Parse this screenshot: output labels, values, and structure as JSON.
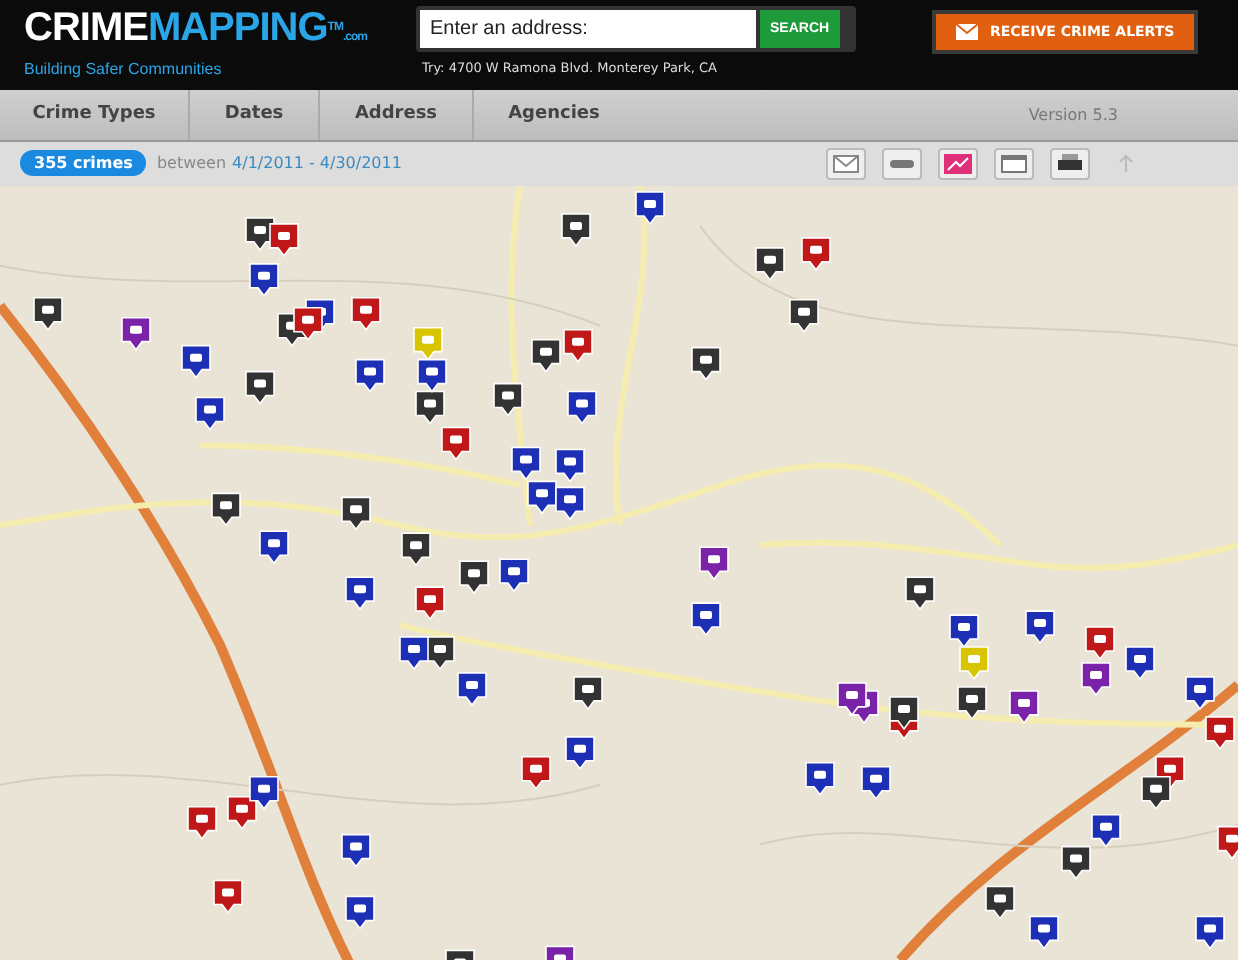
{
  "logo": {
    "part_1": "CRIME",
    "part_2": "MAPPING",
    "mark": "TM",
    "domain": ".com",
    "tagline": "Building Safer Communities"
  },
  "search": {
    "placeholder": "Enter an address:",
    "button": "SEARCH",
    "hint": "Try: 4700 W Ramona Blvd. Monterey Park, CA"
  },
  "alerts_button": "RECEIVE CRIME ALERTS",
  "nav": {
    "items": [
      {
        "label": "Crime Types"
      },
      {
        "label": "Dates"
      },
      {
        "label": "Address"
      },
      {
        "label": "Agencies"
      }
    ],
    "version": "Version 5.3"
  },
  "summary": {
    "count": "355 crimes",
    "between": "between",
    "range": "4/1/2011 - 4/30/2011"
  },
  "tools": [
    {
      "kind": "mail",
      "disabled": false
    },
    {
      "kind": "link",
      "disabled": false
    },
    {
      "kind": "chart",
      "disabled": false
    },
    {
      "kind": "window",
      "disabled": false
    },
    {
      "kind": "print",
      "disabled": false
    },
    {
      "kind": "up",
      "disabled": true
    }
  ]
}
